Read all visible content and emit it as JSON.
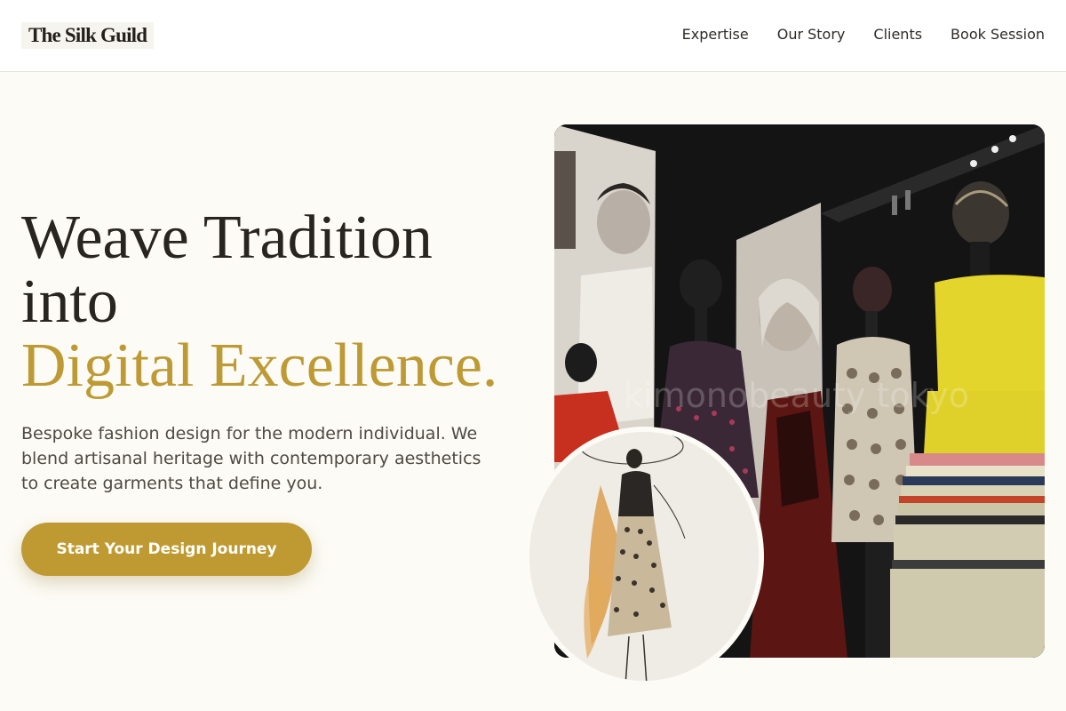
{
  "brand": {
    "name": "The Silk Guild"
  },
  "nav": {
    "items": [
      {
        "label": "Expertise"
      },
      {
        "label": "Our Story"
      },
      {
        "label": "Clients"
      },
      {
        "label": "Book Session"
      }
    ]
  },
  "hero": {
    "headline_line1": "Weave Tradition",
    "headline_line2": "into",
    "headline_accent": "Digital Excellence.",
    "description": "Bespoke fashion design for the modern individual. We blend artisanal heritage with contemporary aesthetics to create garments that define you.",
    "cta_label": "Start Your Design Journey",
    "photo_watermark": "kimonobeauty tokyo"
  },
  "colors": {
    "accent": "#bd9a34",
    "background": "#fcfbf5",
    "text": "#282420"
  },
  "icons": []
}
